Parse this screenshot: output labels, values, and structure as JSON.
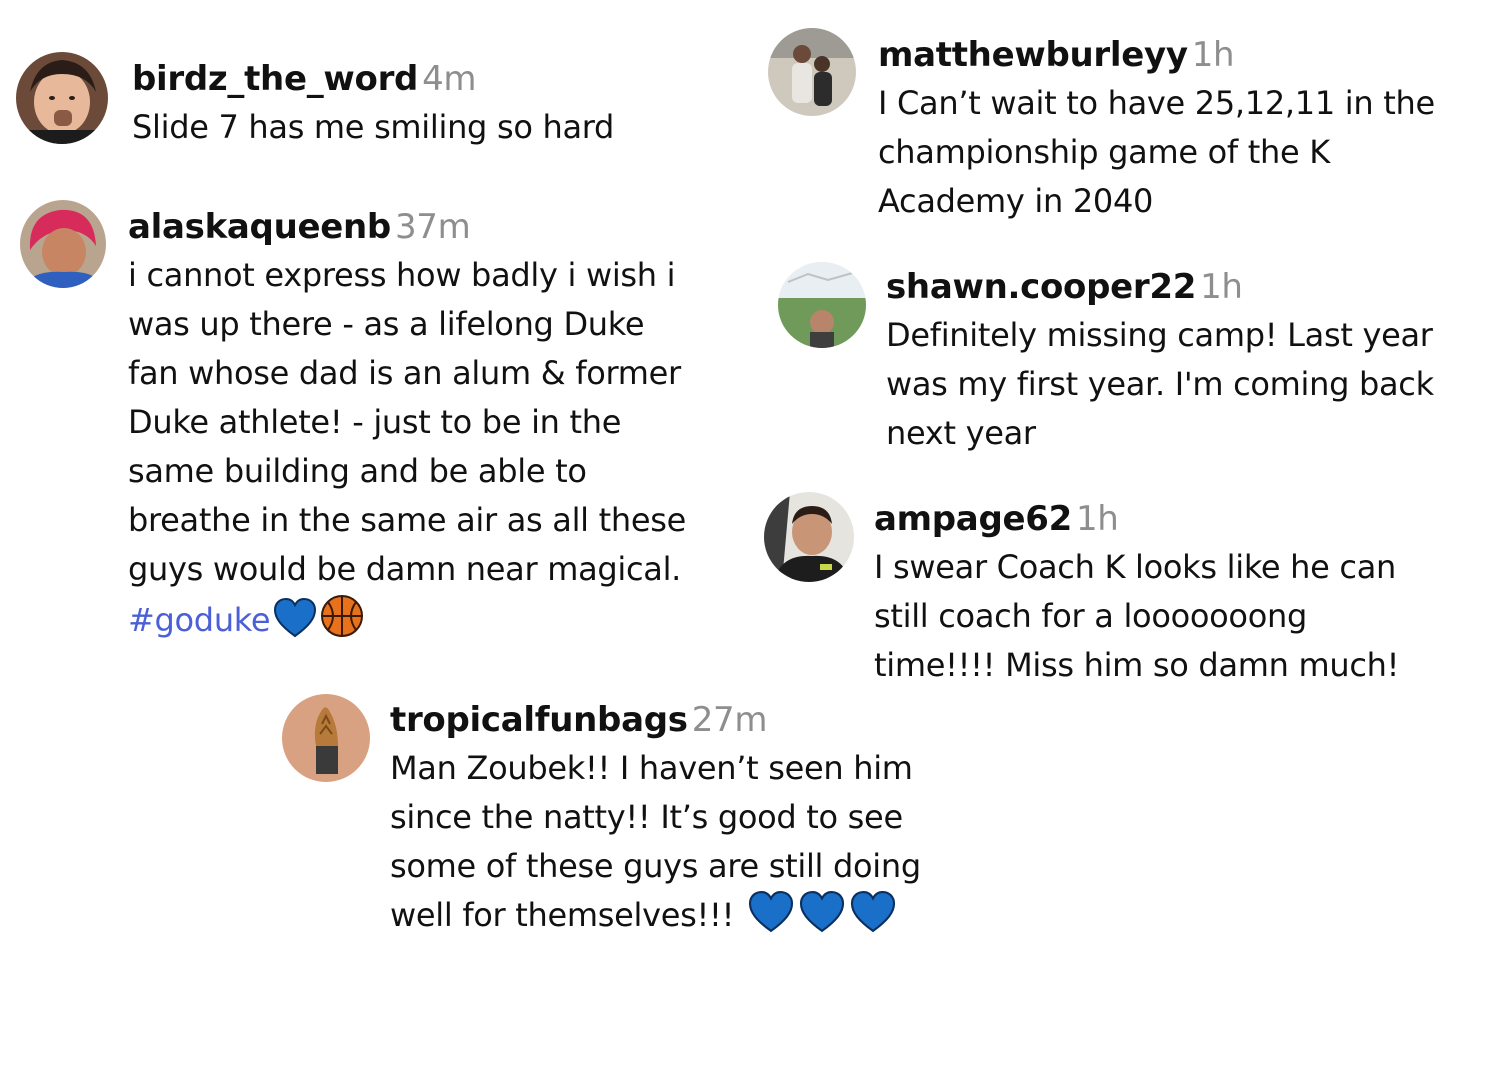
{
  "colors": {
    "username": "#111111",
    "timestamp": "#8e8e8e",
    "hashtag": "#4a5fd8",
    "heart": "#1a6fc9",
    "basketball": "#e8711c"
  },
  "comments": [
    {
      "username": "birdz_the_word",
      "time": "4m",
      "lines": [
        "Slide 7 has me smiling so hard"
      ],
      "icon": "avatar-icon"
    },
    {
      "username": "alaskaqueenb",
      "time": "37m",
      "lines": [
        "i cannot express how badly i wish i",
        "was up there - as a lifelong Duke",
        "fan whose dad is an alum & former",
        "Duke athlete! - just to be in the",
        "same building and be able to",
        "breathe in the same air as all these",
        "guys would be damn near magical."
      ],
      "hashtag": "#goduke",
      "emojis": [
        "blue-heart-icon",
        "basketball-icon"
      ]
    },
    {
      "username": "tropicalfunbags",
      "time": "27m",
      "lines": [
        "Man Zoubek!! I haven’t seen him",
        "since the natty!! It’s good to see",
        "some of these guys are still doing",
        "well for themselves!!!"
      ],
      "emojis": [
        "blue-heart-icon",
        "blue-heart-icon",
        "blue-heart-icon"
      ]
    },
    {
      "username": "matthewburleyy",
      "time": "1h",
      "lines": [
        "I Can’t wait to have 25,12,11 in the",
        "championship game of the K",
        "Academy in 2040"
      ]
    },
    {
      "username": "shawn.cooper22",
      "time": "1h",
      "lines": [
        "Definitely missing camp! Last year",
        "was my first year. I'm coming back",
        "next year"
      ]
    },
    {
      "username": "ampage62",
      "time": "1h",
      "lines": [
        "I swear Coach K looks like he can",
        "still coach for a looooooong",
        "time!!!! Miss him so damn much!"
      ]
    }
  ]
}
